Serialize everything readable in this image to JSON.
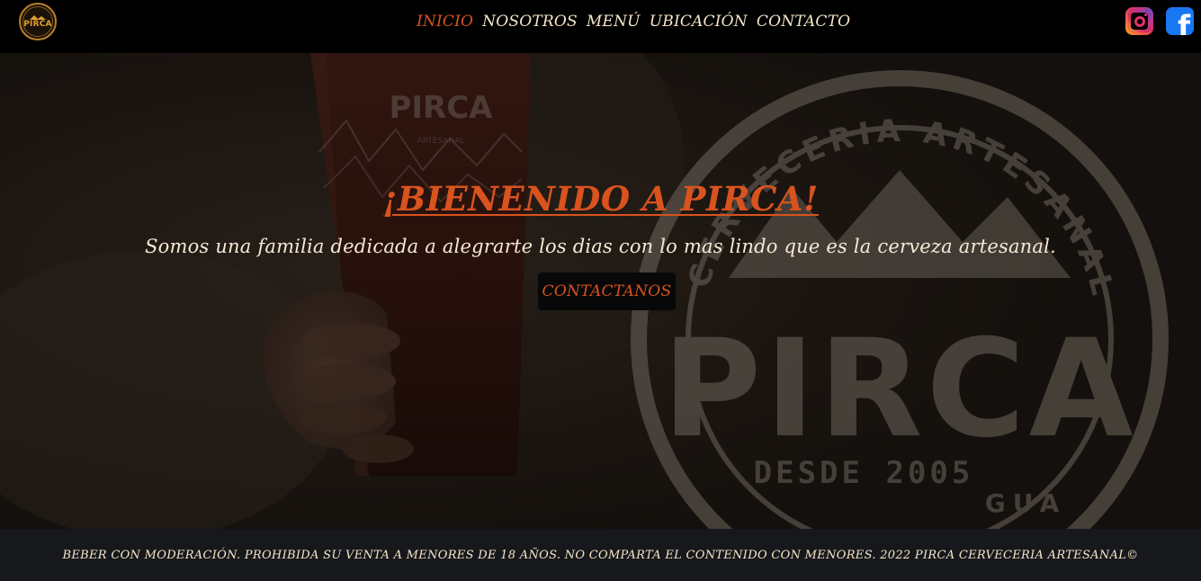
{
  "header": {
    "logo_text": "PIRCA",
    "nav": [
      {
        "label": "INICIO",
        "active": true
      },
      {
        "label": "NOSOTROS",
        "active": false
      },
      {
        "label": "MENÚ",
        "active": false
      },
      {
        "label": "UBICACIÓN",
        "active": false
      },
      {
        "label": "CONTACTO",
        "active": false
      }
    ],
    "social": [
      {
        "icon": "instagram-icon"
      },
      {
        "icon": "facebook-icon"
      }
    ]
  },
  "hero": {
    "title": "¡BIENENIDO A PIRCA!",
    "subtitle": "Somos una familia dedicada a alegrarte los dias con lo mas lindo que es la cerveza artesanal.",
    "cta_label": "CONTACTANOS",
    "glass_brand": "PIRCA",
    "glass_sub": "ARTESANAL",
    "bg_logo": {
      "ring_text": "CERVECERIA ARTESANAL",
      "brand": "PIRCA",
      "since": "DESDE 2005",
      "bottom_text": "GUA"
    }
  },
  "footer": {
    "text": "BEBER CON MODERACIÓN. PROHIBIDA SU VENTA A MENORES DE 18 AÑOS. NO COMPARTA EL CONTENIDO CON MENORES. 2022 PIRCA CERVECERIA ARTESANAL©"
  },
  "colors": {
    "accent": "#d9531e",
    "nav_text": "#f6e6c8",
    "header_bg": "#000000",
    "footer_bg": "#16181c"
  }
}
